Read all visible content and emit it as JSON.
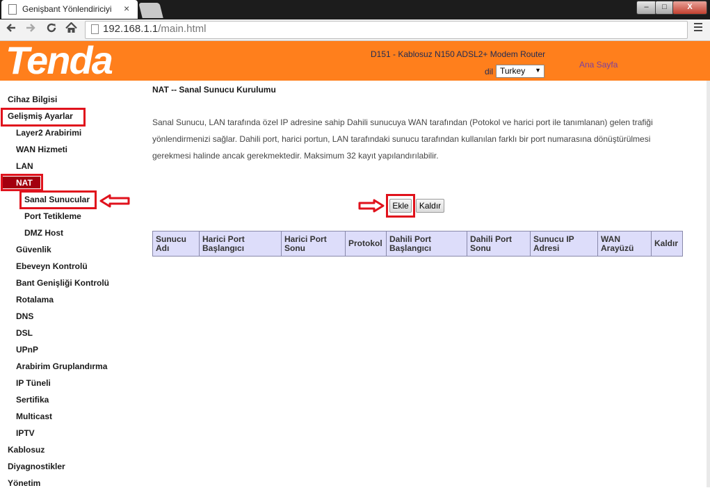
{
  "browser": {
    "tab_title": "Genişbant Yönlendiriciyi",
    "tab_close": "×",
    "url_host": "192.168.1.1",
    "url_path": "/main.html",
    "icons": {
      "back": "arrow-left-icon",
      "forward": "arrow-right-icon",
      "reload": "reload-icon",
      "home": "home-icon",
      "menu": "hamburger-menu-icon"
    },
    "window_buttons": {
      "min": "–",
      "max": "□",
      "close": "X"
    }
  },
  "header": {
    "logo": "Tenda",
    "model": "D151 - Kablosuz N150 ADSL2+ Modem Router",
    "language_label": "dil",
    "language_value": "Turkey",
    "home_link": "Ana Sayfa",
    "colors": {
      "bar": "#ff7f1c",
      "logo_text": "#ffffff"
    }
  },
  "sidebar": {
    "items": [
      {
        "label": "Cihaz Bilgisi"
      },
      {
        "label": "Gelişmiş Ayarlar"
      },
      {
        "label": "Layer2 Arabirimi"
      },
      {
        "label": "WAN Hizmeti"
      },
      {
        "label": "LAN"
      },
      {
        "label": "NAT"
      },
      {
        "label": "Sanal Sunucular"
      },
      {
        "label": "Port Tetikleme"
      },
      {
        "label": "DMZ Host"
      },
      {
        "label": "Güvenlik"
      },
      {
        "label": "Ebeveyn Kontrolü"
      },
      {
        "label": "Bant Genişliği Kontrolü"
      },
      {
        "label": "Rotalama"
      },
      {
        "label": "DNS"
      },
      {
        "label": "DSL"
      },
      {
        "label": "UPnP"
      },
      {
        "label": "Arabirim Gruplandırma"
      },
      {
        "label": "IP Tüneli"
      },
      {
        "label": "Sertifika"
      },
      {
        "label": "Multicast"
      },
      {
        "label": "IPTV"
      },
      {
        "label": "Kablosuz"
      },
      {
        "label": "Diyagnostikler"
      },
      {
        "label": "Yönetim"
      }
    ],
    "active_color": "#a3000e",
    "highlight_color": "#e0121c"
  },
  "main": {
    "title": "NAT -- Sanal Sunucu Kurulumu",
    "description": [
      "Sanal Sunucu, LAN tarafında özel IP adresine sahip Dahili sunucuya WAN tarafından (Potokol ve harici port ile tanımlanan) gelen trafiği",
      "yönlendirmenizi sağlar. Dahili port, harici portun, LAN tarafındaki sunucu tarafından kullanılan farklı bir port numarasına dönüştürülmesi",
      "gerekmesi halinde ancak gerekmektedir. Maksimum 32 kayıt yapılandırılabilir."
    ],
    "buttons": {
      "add": "Ekle",
      "remove": "Kaldır"
    },
    "table": {
      "headers": [
        "Sunucu Adı",
        "Harici Port Başlangıcı",
        "Harici Port Sonu",
        "Protokol",
        "Dahili Port Başlangıcı",
        "Dahili Port Sonu",
        "Sunucu IP Adresi",
        "WAN Arayüzü",
        "Kaldır"
      ],
      "rows": []
    },
    "annotation_arrows": [
      "arrow-left-outline-icon",
      "arrow-right-outline-icon"
    ]
  }
}
